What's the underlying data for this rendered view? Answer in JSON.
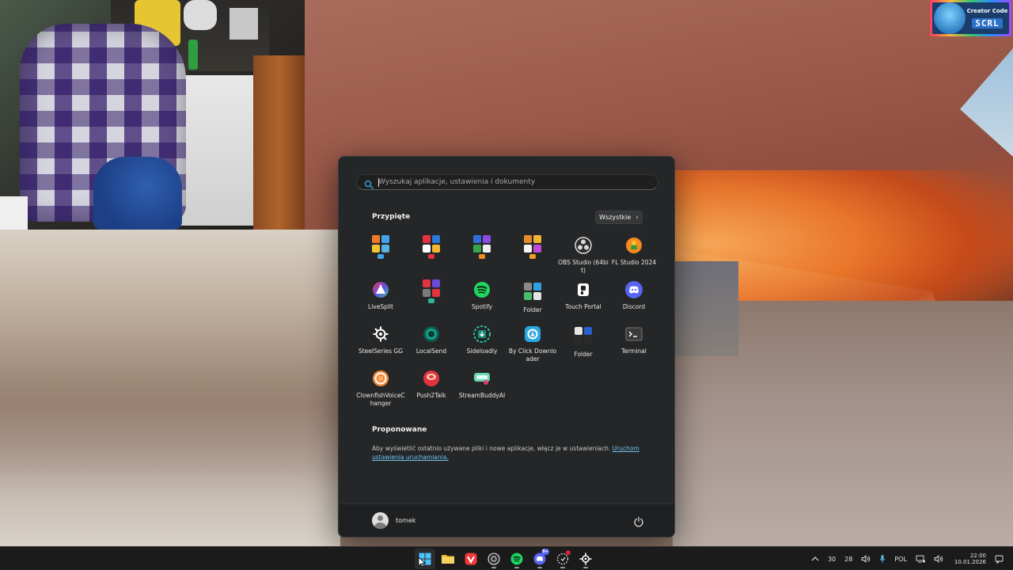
{
  "badge": {
    "title": "Creator Code",
    "code": "SCRL"
  },
  "start_menu": {
    "search_placeholder": "Wyszukaj aplikacje, ustawienia i dokumenty",
    "pinned_title": "Przypięte",
    "all_button": "Wszystkie",
    "pinned": [
      {
        "label": "",
        "icon": "folder-grid-icon",
        "colors": [
          "#f07a2a",
          "#3fa5e8",
          "#f2c230",
          "#56b0e0"
        ],
        "extra": "#3fa5e8"
      },
      {
        "label": "",
        "icon": "folder-grid-icon",
        "colors": [
          "#e2333f",
          "#2a7ad6",
          "#ffffff",
          "#f2b731"
        ],
        "extra": "#e2333f"
      },
      {
        "label": "",
        "icon": "folder-grid-icon",
        "colors": [
          "#2f6ed8",
          "#8a4be0",
          "#3aa34a",
          "#f0f0f0"
        ],
        "extra": "#f08a24"
      },
      {
        "label": "",
        "icon": "folder-grid-icon",
        "colors": [
          "#e88a2c",
          "#f0b830",
          "#f5f5f5",
          "#c24ad8"
        ],
        "extra": "#f0a020"
      },
      {
        "label": "OBS Studio (64bit)",
        "icon": "obs-icon"
      },
      {
        "label": "FL Studio 2024",
        "icon": "fl-studio-icon"
      },
      {
        "label": "LiveSplit",
        "icon": "livesplit-icon"
      },
      {
        "label": "",
        "icon": "folder-grid-icon",
        "colors": [
          "#e2333f",
          "#6a4bd8",
          "#7a7a7a",
          "#e2333f"
        ],
        "extra": "#2fb39a"
      },
      {
        "label": "Spotify",
        "icon": "spotify-icon"
      },
      {
        "label": "Folder",
        "icon": "folder-grid-icon",
        "colors": [
          "#8a8a8a",
          "#2fa0e0",
          "#46c06a",
          "#e5e5e5"
        ],
        "extra": ""
      },
      {
        "label": "Touch Portal",
        "icon": "touch-portal-icon"
      },
      {
        "label": "Discord",
        "icon": "discord-icon"
      },
      {
        "label": "SteelSeries GG",
        "icon": "steelseries-icon"
      },
      {
        "label": "LocalSend",
        "icon": "localsend-icon"
      },
      {
        "label": "Sideloadly",
        "icon": "sideloadly-icon"
      },
      {
        "label": "By Click Downloader",
        "icon": "byclick-icon"
      },
      {
        "label": "Folder",
        "icon": "folder-grid-icon",
        "colors": [
          "#e5e5e5",
          "#2a5fd0",
          "#2a2a2a",
          "#2a2a2a"
        ],
        "extra": ""
      },
      {
        "label": "Terminal",
        "icon": "terminal-icon"
      },
      {
        "label": "ClownfishVoiceChanger",
        "icon": "clownfish-icon"
      },
      {
        "label": "Push2Talk",
        "icon": "push2talk-icon"
      },
      {
        "label": "StreamBuddyAI",
        "icon": "streambuddy-icon"
      }
    ],
    "proposed_title": "Proponowane",
    "proposed_text": "Aby wyświetlić ostatnio używane pliki i nowe aplikacje, włącz je w ustawieniach.",
    "proposed_link": "Uruchom ustawienia uruchamiania.",
    "user_name": "tomek"
  },
  "taskbar": {
    "apps": [
      {
        "name": "start-button",
        "active": true
      },
      {
        "name": "file-explorer-button"
      },
      {
        "name": "vivaldi-button"
      },
      {
        "name": "obs-taskbar-button",
        "indicator": true
      },
      {
        "name": "spotify-taskbar-button",
        "indicator": true
      },
      {
        "name": "discord-taskbar-button",
        "indicator": true,
        "badge": "9+"
      },
      {
        "name": "app-taskbar-button",
        "indicator": true,
        "dot": true
      },
      {
        "name": "steelseries-taskbar-button",
        "indicator": true
      }
    ],
    "tray": {
      "temp_a": "30",
      "temp_b": "28",
      "language": "POL",
      "time": "22:00",
      "date": "10.01.2026"
    }
  }
}
